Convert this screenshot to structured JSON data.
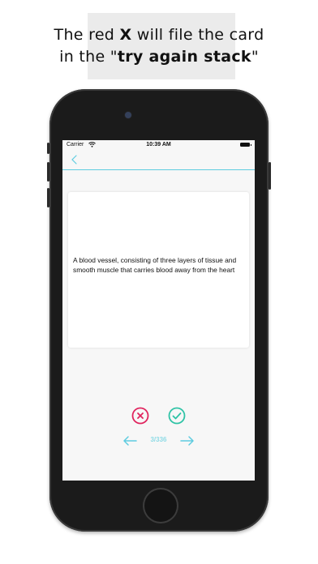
{
  "caption": {
    "line1_pre": "The red ",
    "line1_bold": "X",
    "line1_post": " will file the card",
    "line2_pre": "in the \"",
    "line2_bold": "try again stack",
    "line2_post": "\""
  },
  "status_bar": {
    "carrier": "Carrier",
    "time": "10:39 AM"
  },
  "card": {
    "text": "A blood vessel, consisting of three layers of tissue and smooth muscle that carries blood away from the heart"
  },
  "controls": {
    "counter": "3/336"
  },
  "colors": {
    "accent": "#5fcce0",
    "reject": "#e0245e",
    "accept": "#2fc3a6"
  },
  "icons": [
    "wifi-icon",
    "battery-icon",
    "back-chevron-icon",
    "close-circle-icon",
    "check-circle-icon",
    "arrow-left-icon",
    "arrow-right-icon"
  ]
}
